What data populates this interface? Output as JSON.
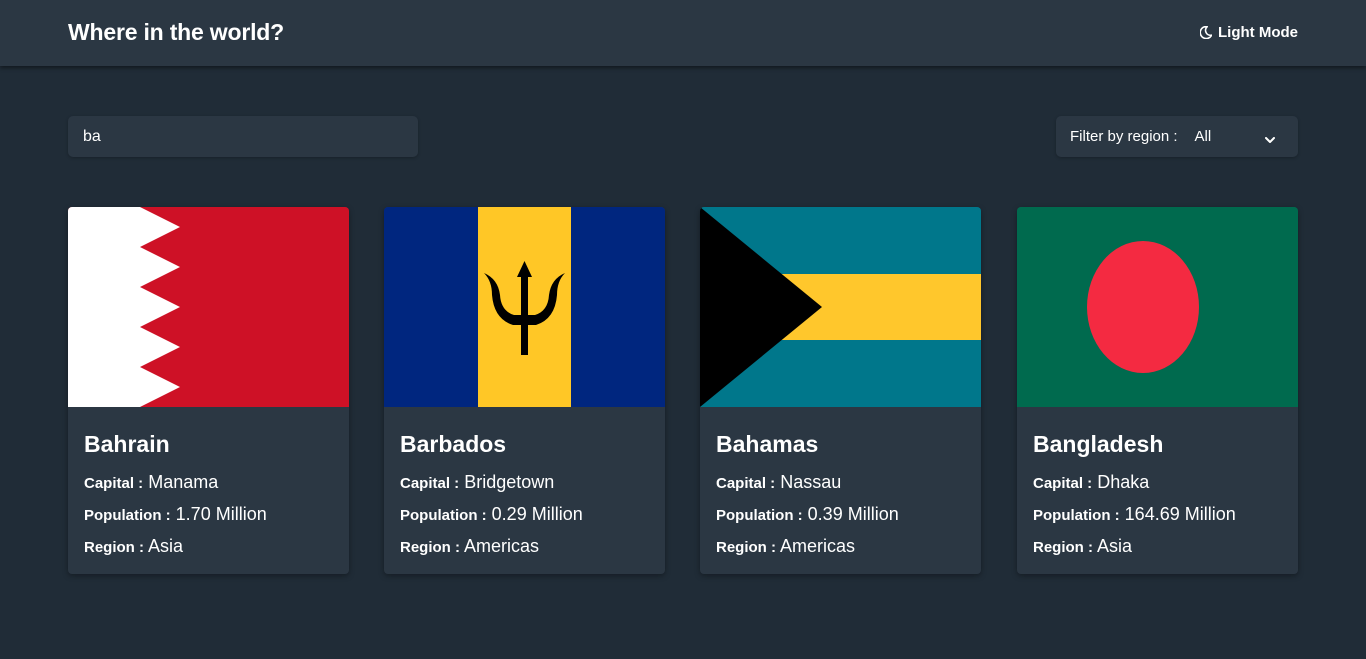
{
  "header": {
    "title": "Where in the world?",
    "mode_toggle_label": "Light Mode",
    "mode_icon": "moon-icon"
  },
  "search": {
    "value": "ba"
  },
  "filter": {
    "label": "Filter by region :",
    "selected": "All",
    "icon": "chevron-down-icon"
  },
  "labels": {
    "capital": "Capital :",
    "population": "Population :",
    "region": "Region :"
  },
  "countries": [
    {
      "name": "Bahrain",
      "capital": "Manama",
      "population": "1.70 Million",
      "region": "Asia"
    },
    {
      "name": "Barbados",
      "capital": "Bridgetown",
      "population": "0.29 Million",
      "region": "Americas"
    },
    {
      "name": "Bahamas",
      "capital": "Nassau",
      "population": "0.39 Million",
      "region": "Americas"
    },
    {
      "name": "Bangladesh",
      "capital": "Dhaka",
      "population": "164.69 Million",
      "region": "Asia"
    }
  ],
  "colors": {
    "background": "#202c37",
    "elements": "#2b3743",
    "text": "#ffffff"
  }
}
